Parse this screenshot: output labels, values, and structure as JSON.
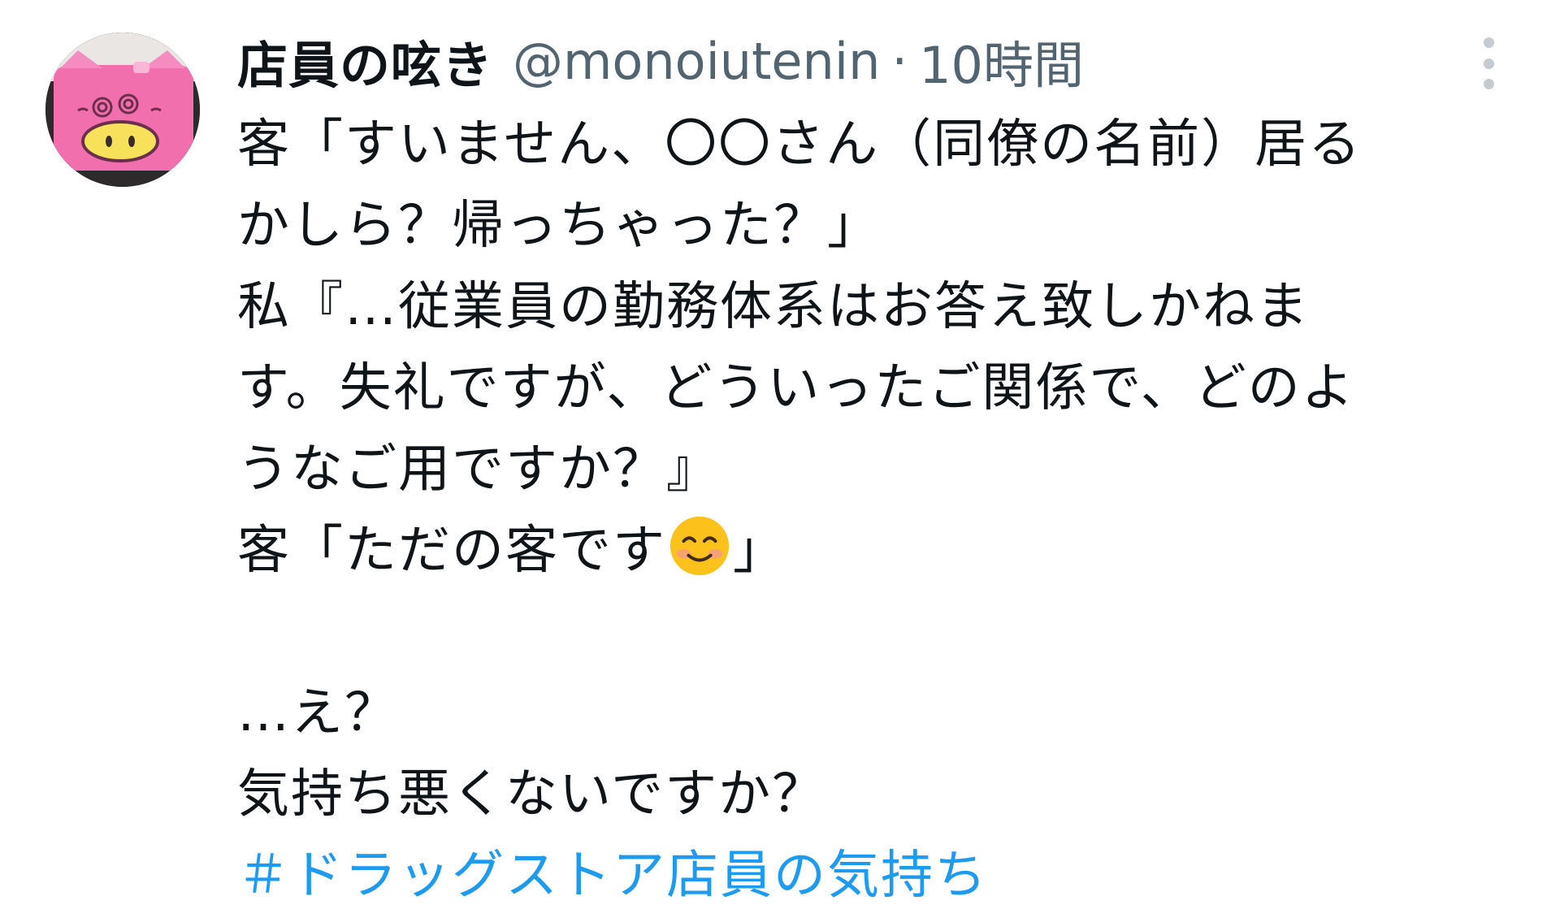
{
  "tweet": {
    "author": {
      "display_name": "店員の呟き",
      "handle": "@monoiutenin",
      "separator": "·",
      "time": "10時間",
      "avatar_icon": "pig-face-avatar"
    },
    "menu_icon": "more-vertical-icon",
    "lines": [
      "客「すいません、〇〇さん（同僚の名前）居る",
      "かしら？帰っちゃった？」",
      "私『…従業員の勤務体系はお答え致しかねま",
      "す。失礼ですが、どういったご関係で、どのよ",
      "うなご用ですか？』"
    ],
    "line6_prefix": "客「ただの客です",
    "line6_emoji": "smiling-face-emoji",
    "line6_suffix": "」",
    "line7": "…え？",
    "line8": "気持ち悪くないですか？",
    "hashtag": "＃ドラッグストア店員の気持ち",
    "colors": {
      "text": "#0f1419",
      "secondary": "#536471",
      "link": "#1d9bf0"
    }
  }
}
